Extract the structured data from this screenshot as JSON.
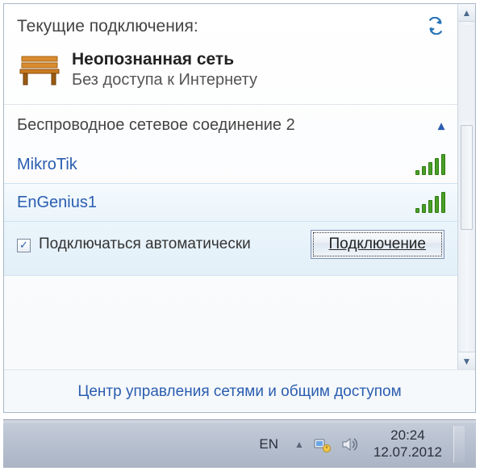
{
  "header": {
    "title": "Текущие подключения:"
  },
  "current": {
    "name": "Неопознанная сеть",
    "status": "Без доступа к Интернету"
  },
  "adapter": {
    "label": "Беспроводное сетевое соединение 2"
  },
  "networks": [
    {
      "name": "MikroTik"
    },
    {
      "name": "EnGenius1"
    }
  ],
  "connect": {
    "auto_label": "Подключаться автоматически",
    "button": "Подключение"
  },
  "footer": {
    "link": "Центр управления сетями и общим доступом"
  },
  "taskbar": {
    "lang": "EN",
    "time": "20:24",
    "date": "12.07.2012"
  }
}
